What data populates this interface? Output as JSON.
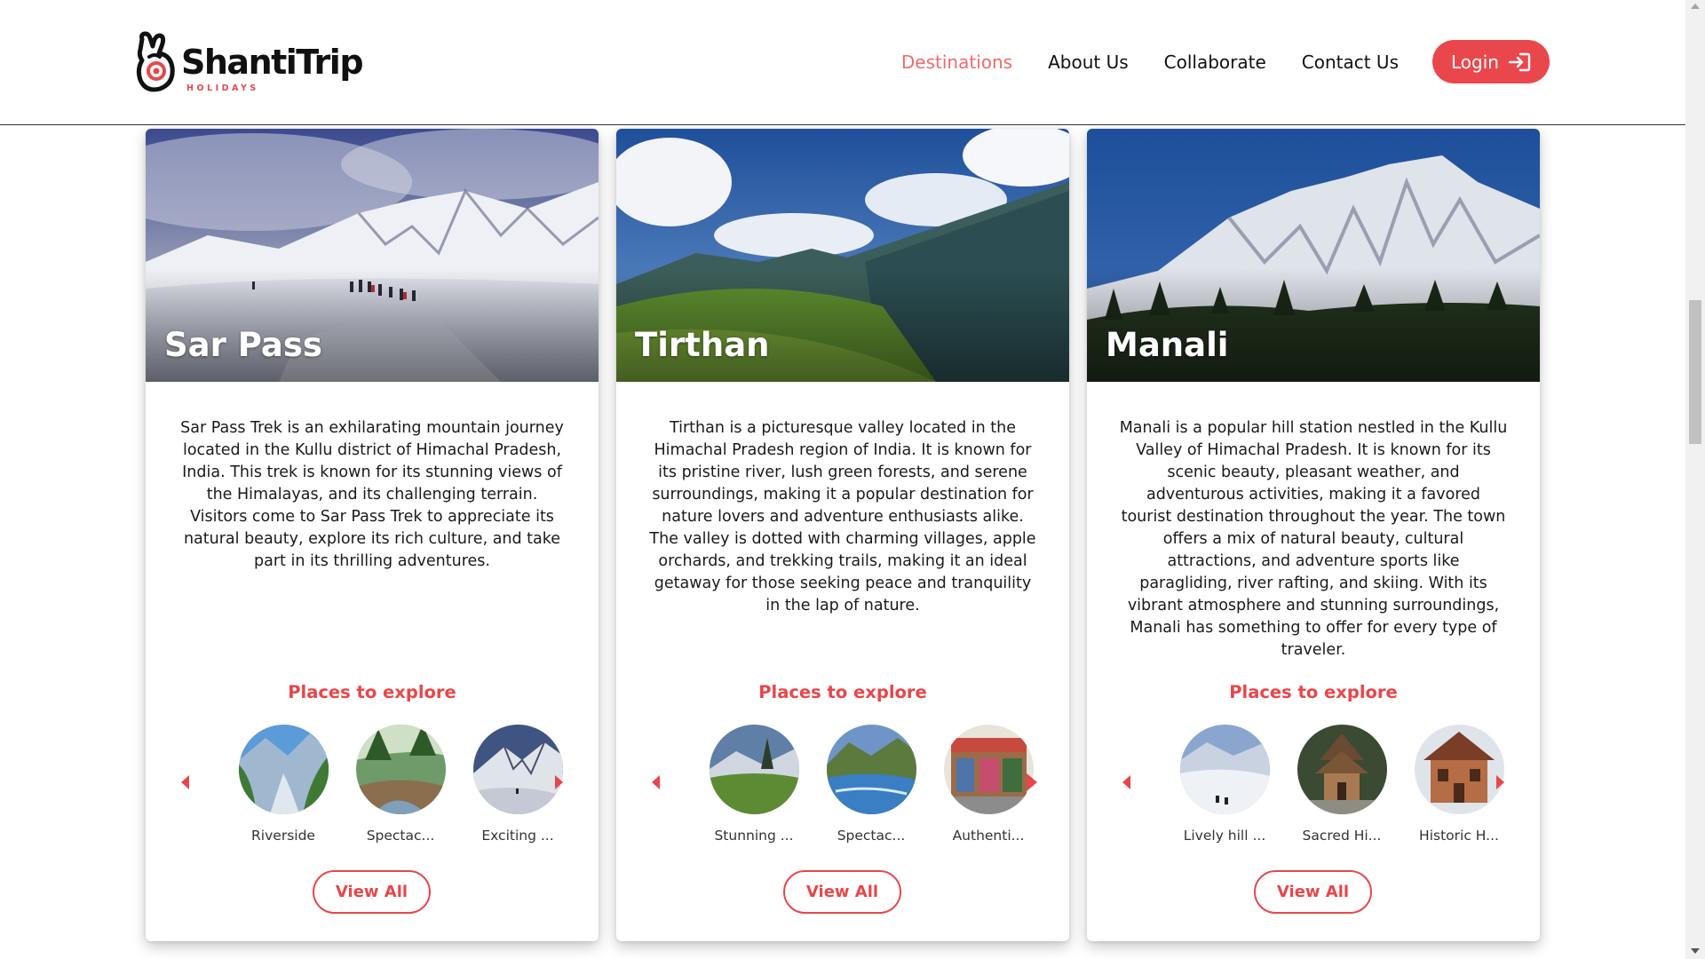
{
  "brand": {
    "name": "ShantiTrip",
    "tagline": "HOLIDAYS",
    "accent_color": "#e8464a"
  },
  "nav": {
    "items": [
      {
        "label": "Destinations",
        "active": true
      },
      {
        "label": "About Us",
        "active": false
      },
      {
        "label": "Collaborate",
        "active": false
      },
      {
        "label": "Contact Us",
        "active": false
      }
    ],
    "login_label": "Login",
    "login_icon": "login-arrow-icon"
  },
  "cards": [
    {
      "title": "Sar Pass",
      "description": "Sar Pass Trek is an exhilarating mountain journey located in the Kullu district of Himachal Pradesh, India. This trek is known for its stunning views of the Himalayas, and its challenging terrain. Visitors come to Sar Pass Trek to appreciate its natural beauty, explore its rich culture, and take part in its thrilling adventures.",
      "places_title": "Places to explore",
      "places": [
        {
          "name": "Riverside"
        },
        {
          "name": "Spectac..."
        },
        {
          "name": "Exciting ..."
        }
      ],
      "view_all_label": "View All"
    },
    {
      "title": "Tirthan",
      "description": "Tirthan is a picturesque valley located in the Himachal Pradesh region of India. It is known for its pristine river, lush green forests, and serene surroundings, making it a popular destination for nature lovers and adventure enthusiasts alike. The valley is dotted with charming villages, apple orchards, and trekking trails, making it an ideal getaway for those seeking peace and tranquility in the lap of nature.",
      "places_title": "Places to explore",
      "places": [
        {
          "name": "Stunning ..."
        },
        {
          "name": "Spectac..."
        },
        {
          "name": "Authenti..."
        }
      ],
      "view_all_label": "View All"
    },
    {
      "title": "Manali",
      "description": "Manali is a popular hill station nestled in the Kullu Valley of Himachal Pradesh. It is known for its scenic beauty, pleasant weather, and adventurous activities, making it a favored tourist destination throughout the year. The town offers a mix of natural beauty, cultural attractions, and adventure sports like paragliding, river rafting, and skiing. With its vibrant atmosphere and stunning surroundings, Manali has something to offer for every type of traveler.",
      "places_title": "Places to explore",
      "places": [
        {
          "name": "Lively hill ..."
        },
        {
          "name": "Sacred Hi..."
        },
        {
          "name": "Historic H..."
        }
      ],
      "view_all_label": "View All"
    }
  ]
}
